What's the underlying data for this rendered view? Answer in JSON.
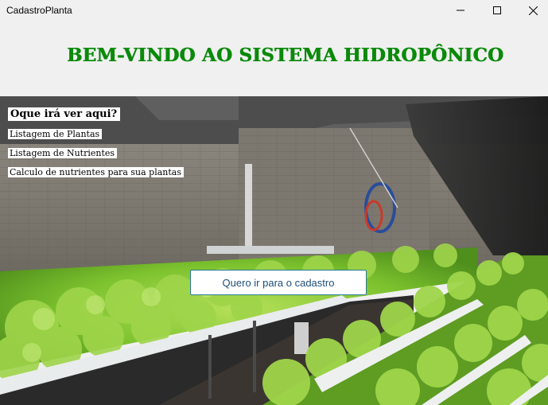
{
  "window": {
    "title": "CadastroPlanta",
    "minimize_icon": "minimize-icon",
    "maximize_icon": "maximize-icon",
    "close_icon": "close-icon"
  },
  "header": {
    "title": "BEM-VINDO AO SISTEMA HIDROPÔNICO",
    "title_color": "#0a8a0a"
  },
  "info": {
    "heading": "Oque irá ver aqui?",
    "items": [
      "Listagem de Plantas",
      "Listagem de Nutrientes",
      "Calculo de nutrientes para sua plantas"
    ]
  },
  "cta": {
    "label": "Quero ir para o cadastro"
  }
}
